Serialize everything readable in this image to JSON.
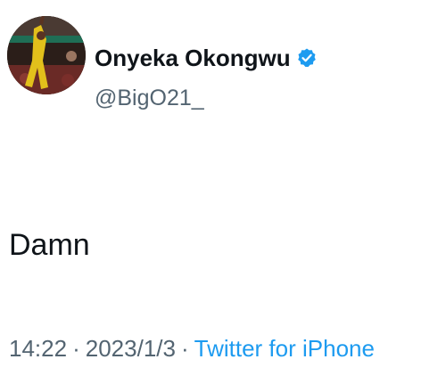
{
  "tweet": {
    "author": {
      "display_name": "Onyeka Okongwu",
      "handle": "@BigO21_",
      "verified": true,
      "avatar_icon": "avatar-photo"
    },
    "text": "Damn",
    "meta": {
      "time": "14:22",
      "separator": "·",
      "date": "2023/1/3",
      "source": "Twitter for iPhone"
    }
  },
  "colors": {
    "text_primary": "#0f1419",
    "text_secondary": "#536471",
    "accent": "#1d9bf0",
    "background": "#ffffff"
  }
}
